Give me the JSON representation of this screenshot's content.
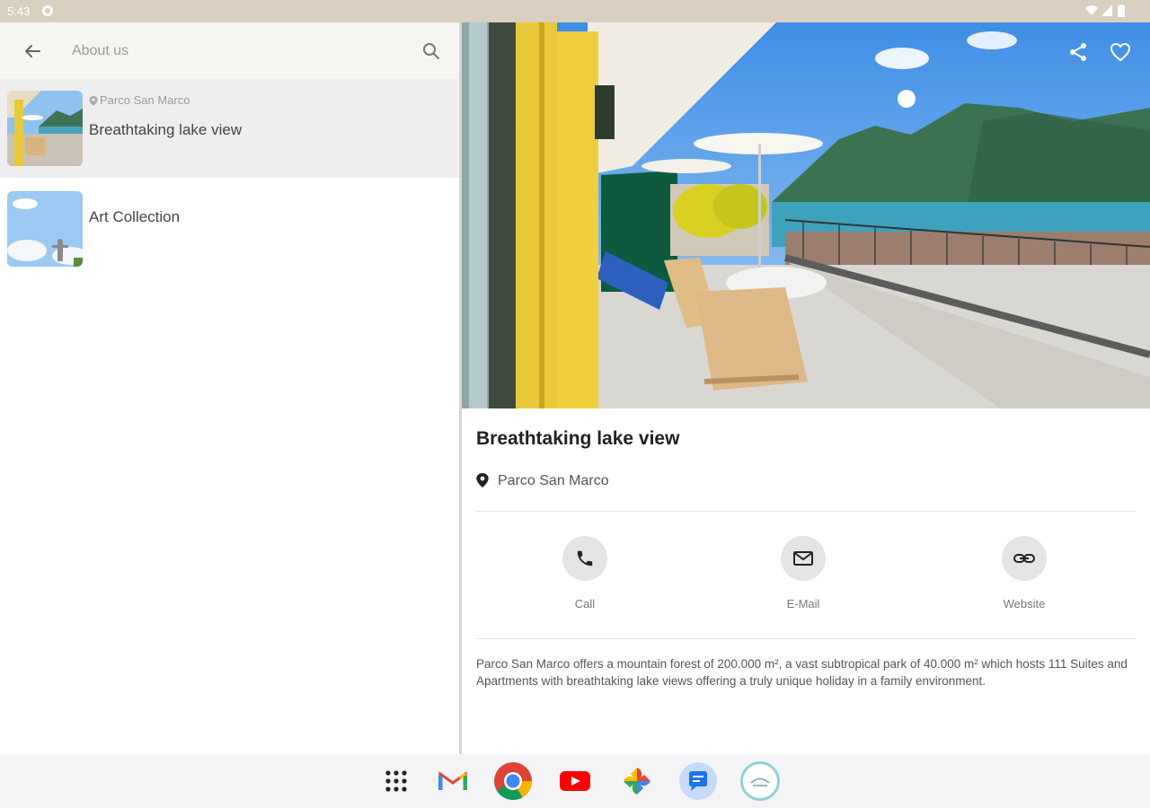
{
  "status": {
    "time": "5:43"
  },
  "appbar": {
    "title": "About us"
  },
  "list": [
    {
      "location": "Parco San Marco",
      "name": "Breathtaking lake view"
    },
    {
      "name": "Art Collection"
    }
  ],
  "detail": {
    "title": "Breathtaking lake view",
    "location": "Parco San Marco",
    "actions": [
      {
        "label": "Call",
        "icon": "phone-icon"
      },
      {
        "label": "E-Mail",
        "icon": "mail-icon"
      },
      {
        "label": "Website",
        "icon": "link-icon"
      }
    ],
    "description": "Parco San Marco offers a mountain forest of 200.000 m², a vast subtropical park of 40.000 m² which hosts 111 Suites and Apartments with breathtaking lake views offering a truly unique holiday in a family environment."
  },
  "dock": [
    "apps-grid-icon",
    "gmail-icon",
    "chrome-icon",
    "youtube-icon",
    "photos-icon",
    "messages-icon",
    "hotel-app-icon"
  ],
  "colors": {
    "statusbar": "#d8cfbe",
    "appbar": "#f7f5f1",
    "selected": "#eeeeee",
    "accent_yellow": "#e9c93a"
  }
}
